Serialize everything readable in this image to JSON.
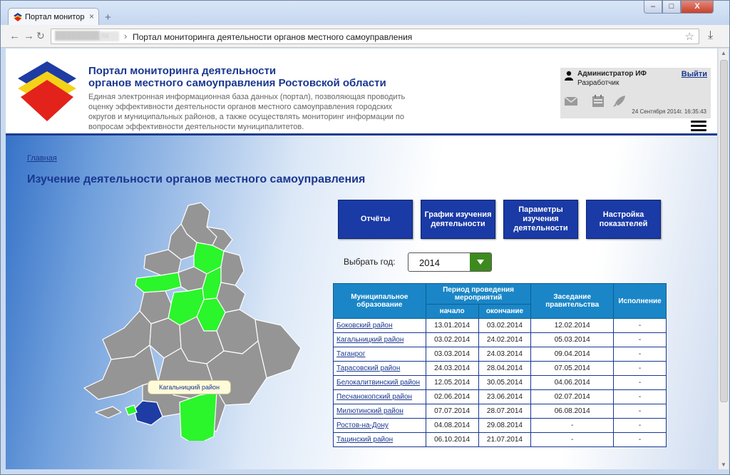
{
  "browser": {
    "tab_title": "Портал мониторинга",
    "tab_close": "×",
    "new_tab": "+",
    "url_host": "████████.ru",
    "url_sep": "›",
    "url_title": "Портал мониторинга деятельности органов местного самоуправления",
    "controls": {
      "minimize": "–",
      "maximize": "□",
      "close": "X"
    }
  },
  "header": {
    "title_line1": "Портал мониторинга деятельности",
    "title_line2": "органов местного самоуправления Ростовской области",
    "description": "Единая электронная информационная база данных (портал), позволяющая проводить оценку эффективности деятельности органов местного самоуправления городских округов и муниципальных районов, а также осуществлять мониторинг информации по вопросам эффективности деятельности муниципалитетов.",
    "logo_colors": [
      "#1e3ca4",
      "#f5d21a",
      "#e3221c"
    ]
  },
  "user": {
    "name": "Администратор ИФ",
    "role": "Разработчик",
    "logout": "Выйти",
    "datetime": "24 Сентября 2014г. 16:35:43"
  },
  "breadcrumb": "Главная",
  "page_title": "Изучение деятельности органов местного самоуправления",
  "buttons": {
    "reports": "Отчёты",
    "schedule": "График изучения деятельности",
    "params": "Параметры изучения деятельности",
    "settings": "Настройка показателей"
  },
  "year": {
    "label": "Выбрать год:",
    "value": "2014"
  },
  "map": {
    "tooltip": "Кагальницкий район",
    "colors": {
      "default": "#959595",
      "highlight": "#2bf52b",
      "selected": "#1e3ca4",
      "border": "#ffffff"
    }
  },
  "table": {
    "headers": {
      "municipality": "Муниципальное образование",
      "period": "Период проведения мероприятий",
      "start": "начало",
      "end": "окончание",
      "meeting": "Заседание правительства",
      "execution": "Исполнение"
    },
    "rows": [
      {
        "name": "Боковский район",
        "start": "13.01.2014",
        "end": "03.02.2014",
        "meeting": "12.02.2014",
        "execution": "-"
      },
      {
        "name": "Кагальницкий район",
        "start": "03.02.2014",
        "end": "24.02.2014",
        "meeting": "05.03.2014",
        "execution": "-"
      },
      {
        "name": "Таганрог",
        "start": "03.03.2014",
        "end": "24.03.2014",
        "meeting": "09.04.2014",
        "execution": "-"
      },
      {
        "name": "Тарасовский район",
        "start": "24.03.2014",
        "end": "28.04.2014",
        "meeting": "07.05.2014",
        "execution": "-"
      },
      {
        "name": "Белокалитвинский район",
        "start": "12.05.2014",
        "end": "30.05.2014",
        "meeting": "04.06.2014",
        "execution": "-"
      },
      {
        "name": "Песчанокопский район",
        "start": "02.06.2014",
        "end": "23.06.2014",
        "meeting": "02.07.2014",
        "execution": "-"
      },
      {
        "name": "Милютинский район",
        "start": "07.07.2014",
        "end": "28.07.2014",
        "meeting": "06.08.2014",
        "execution": "-"
      },
      {
        "name": "Ростов-на-Дону",
        "start": "04.08.2014",
        "end": "29.08.2014",
        "meeting": "-",
        "execution": "-"
      },
      {
        "name": "Тацинский район",
        "start": "06.10.2014",
        "end": "21.07.2014",
        "meeting": "-",
        "execution": "-"
      }
    ]
  }
}
